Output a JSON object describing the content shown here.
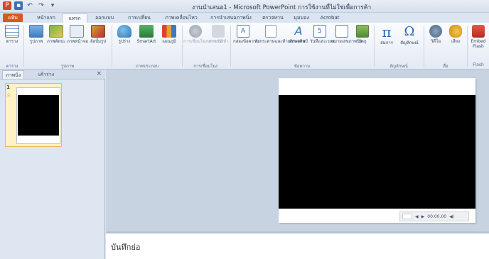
{
  "window": {
    "title": "งานนำเสนอ1 - Microsoft PowerPoint การใช้งานที่ไม่ใช่เพื่อการค้า"
  },
  "ribbon": {
    "file_tab": "แฟ้ม",
    "tabs": [
      "หน้าแรก",
      "แทรก",
      "ออกแบบ",
      "การเปลี่ยน",
      "ภาพเคลื่อนไหว",
      "การนำเสนอภาพนิ่ง",
      "ตรวจทาน",
      "มุมมอง",
      "Acrobat"
    ],
    "groups": {
      "table": {
        "label": "ตาราง",
        "items": [
          "ตาราง"
        ]
      },
      "images": {
        "label": "รูปภาพ",
        "items": [
          "รูปภาพ",
          "ภาพตัดปะ",
          "ภาพหน้าจอ",
          "อัลบั้มรูป"
        ]
      },
      "illustrations": {
        "label": "ภาพประกอบ",
        "items": [
          "รูปร่าง",
          "SmartArt",
          "แผนภูมิ"
        ]
      },
      "links": {
        "label": "การเชื่อมโยง",
        "items": [
          "การเชื่อมโยงหลายมิติ",
          "การกระทำ"
        ]
      },
      "text": {
        "label": "ข้อความ",
        "items": [
          "กล่องข้อความ",
          "หัวกระดาษและท้ายกระดาษ",
          "อักษรศิลป์",
          "วันที่และเวลา",
          "หมายเลขภาพนิ่ง",
          "วัตถุ"
        ]
      },
      "symbols": {
        "label": "สัญลักษณ์",
        "items": [
          "สมการ",
          "สัญลักษณ์"
        ]
      },
      "media": {
        "label": "สื่อ",
        "items": [
          "วิดีโอ",
          "เสียง"
        ]
      },
      "flash": {
        "label": "Flash",
        "items": [
          "Embed Flash"
        ]
      }
    }
  },
  "left_pane": {
    "tabs": [
      "ภาพนิ่ง",
      "เค้าร่าง"
    ],
    "close_glyph": "×",
    "slide_number": "1"
  },
  "media_controls": {
    "time": "00:00.00"
  },
  "notes": {
    "placeholder": "บันทึกย่อ"
  }
}
